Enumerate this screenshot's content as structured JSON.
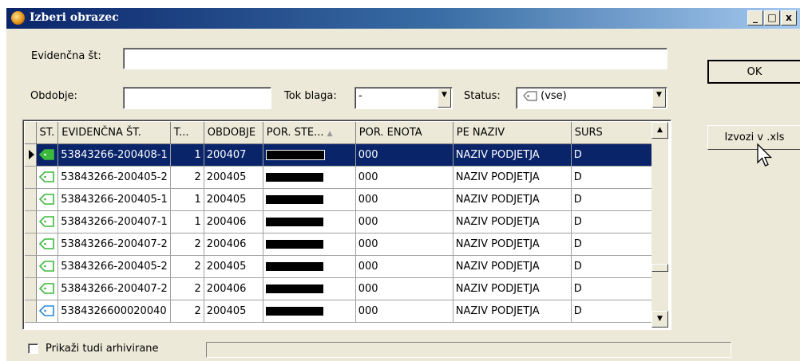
{
  "window": {
    "title": "Izberi obrazec",
    "min": "_",
    "max": "□",
    "close": "x"
  },
  "form": {
    "evidencna_label": "Evidenčna št:",
    "evidencna_value": "",
    "obdobje_label": "Obdobje:",
    "obdobje_value": "",
    "tok_label": "Tok blaga:",
    "tok_value": "-",
    "status_label": "Status:",
    "status_value": "(vse)"
  },
  "buttons": {
    "ok": "OK",
    "export": "Izvozi v .xls"
  },
  "grid": {
    "columns": [
      "ST.",
      "EVIDENČNA ŠT.",
      "T...",
      "OBDOBJE",
      "POR. STE...",
      "POR. ENOTA",
      "PE NAZIV",
      "SURS"
    ],
    "rows": [
      {
        "ev": "53843266-200408-1",
        "t": "1",
        "obd": "200407",
        "enota": "000",
        "naziv": "NAZIV PODJETJA",
        "surs": "D",
        "icon": "green",
        "selected": true
      },
      {
        "ev": "53843266-200405-2",
        "t": "2",
        "obd": "200405",
        "enota": "000",
        "naziv": "NAZIV PODJETJA",
        "surs": "D",
        "icon": "green-outline",
        "selected": false
      },
      {
        "ev": "53843266-200405-1",
        "t": "1",
        "obd": "200405",
        "enota": "000",
        "naziv": "NAZIV PODJETJA",
        "surs": "D",
        "icon": "green-outline",
        "selected": false
      },
      {
        "ev": "53843266-200407-1",
        "t": "1",
        "obd": "200406",
        "enota": "000",
        "naziv": "NAZIV PODJETJA",
        "surs": "D",
        "icon": "green-outline",
        "selected": false
      },
      {
        "ev": "53843266-200407-2",
        "t": "2",
        "obd": "200406",
        "enota": "000",
        "naziv": "NAZIV PODJETJA",
        "surs": "D",
        "icon": "green-outline",
        "selected": false
      },
      {
        "ev": "53843266-200405-2",
        "t": "2",
        "obd": "200405",
        "enota": "000",
        "naziv": "NAZIV PODJETJA",
        "surs": "D",
        "icon": "green-outline",
        "selected": false
      },
      {
        "ev": "53843266-200407-2",
        "t": "2",
        "obd": "200406",
        "enota": "000",
        "naziv": "NAZIV PODJETJA",
        "surs": "D",
        "icon": "green-outline",
        "selected": false
      },
      {
        "ev": "5384326600020040",
        "t": "2",
        "obd": "200405",
        "enota": "000",
        "naziv": "NAZIV PODJETJA",
        "surs": "D",
        "icon": "blue",
        "selected": false
      }
    ]
  },
  "footer": {
    "archive_label": "Prikaži tudi arhivirane",
    "archive_checked": false
  },
  "colors": {
    "selection": "#0a246a",
    "face": "#ece9d8",
    "icon_green": "#3cb83c",
    "icon_blue": "#2a88d8"
  },
  "icons": {
    "app": "app-icon",
    "status": "tag-icon",
    "row_pointer": "row-pointer-icon",
    "cursor": "mouse-pointer-icon"
  }
}
